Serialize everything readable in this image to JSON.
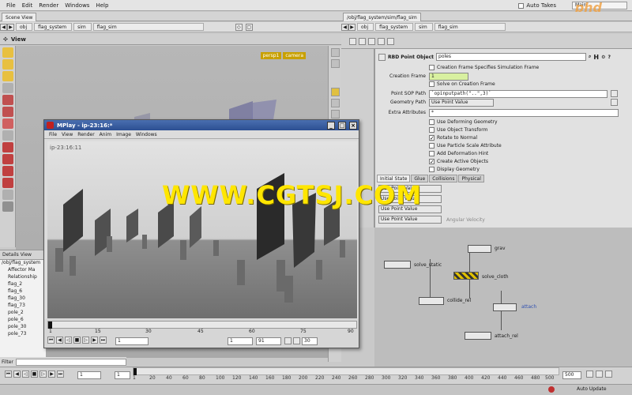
{
  "menubar": {
    "items": [
      "File",
      "Edit",
      "Render",
      "Windows",
      "Help"
    ],
    "auto_takes": "Auto Takes",
    "main_field": "Main",
    "logo": "phd"
  },
  "left_pane": {
    "tab": "Scene View",
    "crumbs": [
      "obj",
      "flag_system",
      "sim",
      "flag_sim"
    ],
    "view_label": "View",
    "cam_labels": [
      "persp1",
      "camera"
    ]
  },
  "right_pane": {
    "tab": "/obj/flag_system/sim/flag_sim",
    "crumbs": [
      "obj",
      "flag_system",
      "sim",
      "flag_sim"
    ]
  },
  "params": {
    "node_type": "RBD Point Object",
    "node_name": "poles",
    "checkbox_top": {
      "label": "Creation Frame Specifies Simulation Frame",
      "checked": false
    },
    "creation_frame_label": "Creation Frame",
    "creation_frame_value": "1",
    "solve_on_creation": "Solve on Creation Frame",
    "point_sop_label": "Point SOP Path",
    "point_sop_value": "`opinputpath(\"..\",3)`",
    "geometry_path_label": "Geometry Path",
    "geometry_path_value": "Use Point Value",
    "extra_attr_label": "Extra Attributes",
    "extra_attr_value": "*",
    "options": [
      {
        "label": "Use Deforming Geometry",
        "checked": false
      },
      {
        "label": "Use Object Transform",
        "checked": false
      },
      {
        "label": "Rotate to Normal",
        "checked": true
      },
      {
        "label": "Use Particle Scale Attribute",
        "checked": false
      },
      {
        "label": "Add Deformation Hint",
        "checked": false
      },
      {
        "label": "Create Active Objects",
        "checked": true
      },
      {
        "label": "Display Geometry",
        "checked": false
      }
    ],
    "tabs": [
      "Initial State",
      "Glue",
      "Collisions",
      "Physical"
    ],
    "initial_rows": [
      "Use Point Value",
      "Use Point Value",
      "Use Point Value",
      "Use Point Value"
    ],
    "angular_velocity": "Angular Velocity"
  },
  "network": {
    "nodes": [
      "grav",
      "solve_static",
      "solve_cloth",
      "collide_rel",
      "attach",
      "attach_rel"
    ]
  },
  "details": {
    "title": "Details View",
    "tree": [
      "/obj/flag_system",
      "Affector Ma",
      "Relationship",
      "flag_2",
      "flag_6",
      "flag_30",
      "flag_73",
      "pole_2",
      "pole_6",
      "pole_30",
      "pole_73"
    ]
  },
  "filter_label": "Filter",
  "mplay": {
    "title": "MPlay - ip-23:16:*",
    "menu": [
      "File",
      "View",
      "Render",
      "Anim",
      "Image",
      "Windows"
    ],
    "frame_label": "ip-23:16:11",
    "ticks": [
      "1",
      "15",
      "30",
      "45",
      "60",
      "75",
      "90"
    ],
    "frame_field": "1",
    "range_start": "1",
    "range_end": "91",
    "fps": "30"
  },
  "timeline": {
    "ticks": [
      "1",
      "20",
      "40",
      "60",
      "80",
      "100",
      "120",
      "140",
      "160",
      "180",
      "200",
      "220",
      "240",
      "260",
      "280",
      "300",
      "320",
      "340",
      "360",
      "380",
      "400",
      "420",
      "440",
      "460",
      "480",
      "500"
    ],
    "frame_field": "1",
    "end_field": "500",
    "auto_update": "Auto Update"
  },
  "watermark": "WWW.CGTSJ.COM"
}
